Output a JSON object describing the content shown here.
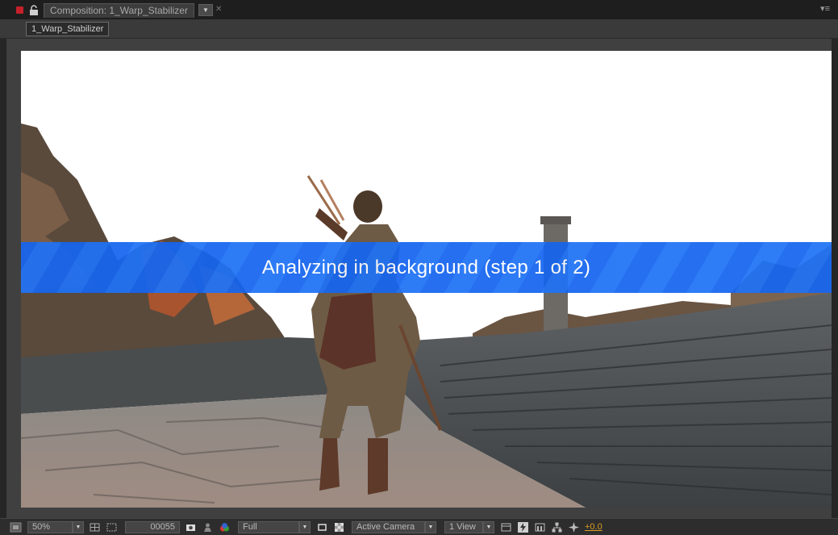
{
  "panel": {
    "tab_title": "Composition: 1_Warp_Stabilizer",
    "tab_menu_icon": "dropdown-arrow-icon",
    "tab_close_icon": "close-icon",
    "panel_menu_icon": "panel-menu-icon",
    "breadcrumb": "1_Warp_Stabilizer"
  },
  "viewer": {
    "banner_text": "Analyzing in background (step 1 of 2)",
    "banner_color": "#1565ef"
  },
  "toolbar": {
    "magnification": "50%",
    "timecode": "00055",
    "resolution": "Full",
    "view": "Active Camera",
    "layout": "1 View",
    "exposure": "+0.0",
    "exposure_color": "#d99b25"
  }
}
